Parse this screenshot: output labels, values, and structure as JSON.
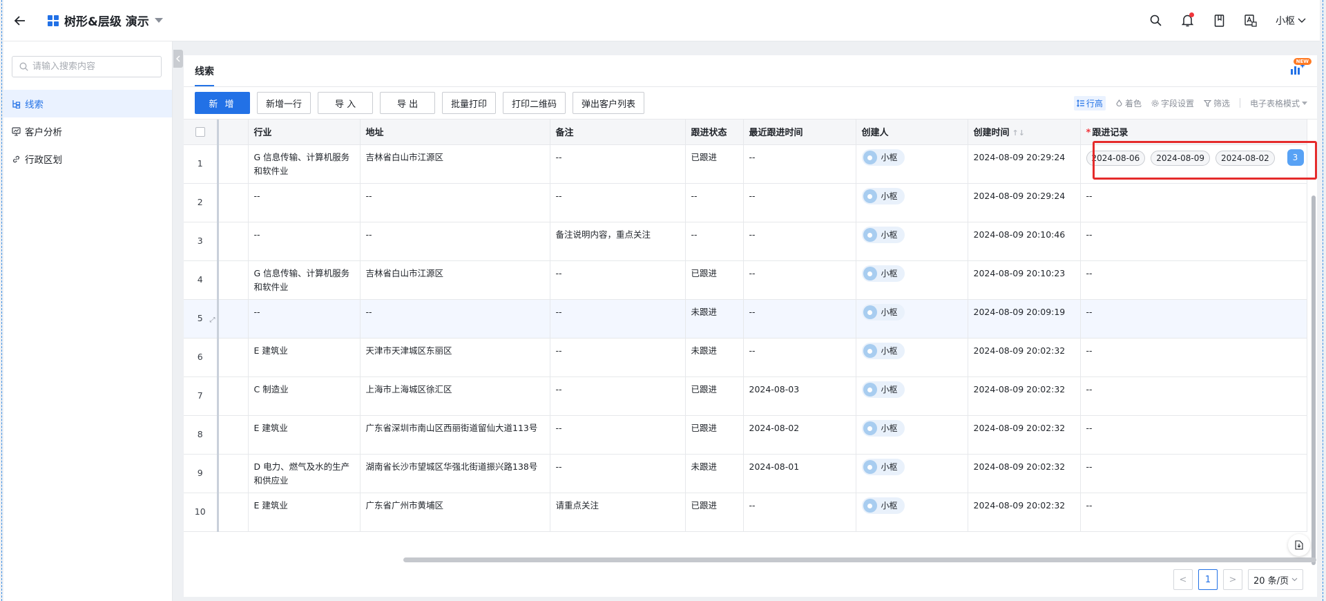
{
  "header": {
    "title": "树形&层级 演示",
    "user_name": "小枢",
    "icons": [
      "back-arrow-icon",
      "app-grid-icon",
      "search-icon",
      "bell-icon",
      "book-icon",
      "translate-icon",
      "chevron-down-icon"
    ],
    "notification_dot_color": "#f0353b"
  },
  "sidebar": {
    "search_placeholder": "请输入搜索内容",
    "items": [
      {
        "label": "线索",
        "icon": "tree-icon",
        "active": true
      },
      {
        "label": "客户分析",
        "icon": "chart-screen-icon",
        "active": false
      },
      {
        "label": "行政区划",
        "icon": "link-icon",
        "active": false
      }
    ]
  },
  "tabs": [
    {
      "label": "线索",
      "active": true
    }
  ],
  "widget_badge": "NEW",
  "toolbar": {
    "add": "新 增",
    "add_row": "新增一行",
    "import": "导 入",
    "export": "导 出",
    "batch_print": "批量打印",
    "print_qr": "打印二维码",
    "popup_list": "弹出客户列表",
    "row_height": "行高",
    "coloring": "着色",
    "field_settings": "字段设置",
    "filter": "筛选",
    "sheet_mode": "电子表格模式"
  },
  "table": {
    "columns": [
      "行业",
      "地址",
      "备注",
      "跟进状态",
      "最近跟进时间",
      "创建人",
      "创建时间",
      "跟进记录"
    ],
    "required_marker": "*",
    "rows": [
      {
        "no": "1",
        "industry": "G 信息传输、计算机服务和软件业",
        "address": "吉林省白山市江源区",
        "remark": "--",
        "status": "已跟进",
        "last_follow": "--",
        "creator": "小枢",
        "created": "2024-08-09 20:29:24",
        "records": [
          "2024-08-06",
          "2024-08-09",
          "2024-08-02"
        ],
        "records_count": "3"
      },
      {
        "no": "2",
        "industry": "--",
        "address": "--",
        "remark": "--",
        "status": "--",
        "last_follow": "--",
        "creator": "小枢",
        "created": "2024-08-09 20:29:24",
        "records_text": "--"
      },
      {
        "no": "3",
        "industry": "--",
        "address": "--",
        "remark": "备注说明内容，重点关注",
        "status": "--",
        "last_follow": "--",
        "creator": "小枢",
        "created": "2024-08-09 20:10:46",
        "records_text": "--"
      },
      {
        "no": "4",
        "industry": "G 信息传输、计算机服务和软件业",
        "address": "吉林省白山市江源区",
        "remark": "--",
        "status": "已跟进",
        "last_follow": "--",
        "creator": "小枢",
        "created": "2024-08-09 20:10:23",
        "records_text": "--"
      },
      {
        "no": "5",
        "industry": "--",
        "address": "--",
        "remark": "--",
        "status": "未跟进",
        "last_follow": "--",
        "creator": "小枢",
        "created": "2024-08-09 20:09:19",
        "records_text": "--",
        "highlight": true
      },
      {
        "no": "6",
        "industry": "E 建筑业",
        "address": "天津市天津城区东丽区",
        "remark": "--",
        "status": "未跟进",
        "last_follow": "--",
        "creator": "小枢",
        "created": "2024-08-09 20:02:32",
        "records_text": "--"
      },
      {
        "no": "7",
        "industry": "C 制造业",
        "address": "上海市上海城区徐汇区",
        "remark": "--",
        "status": "已跟进",
        "last_follow": "2024-08-03",
        "creator": "小枢",
        "created": "2024-08-09 20:02:32",
        "records_text": "--"
      },
      {
        "no": "8",
        "industry": "E 建筑业",
        "address": "广东省深圳市南山区西丽街道留仙大道113号",
        "remark": "--",
        "status": "已跟进",
        "last_follow": "2024-08-02",
        "creator": "小枢",
        "created": "2024-08-09 20:02:32",
        "records_text": "--"
      },
      {
        "no": "9",
        "industry": "D 电力、燃气及水的生产和供应业",
        "address": "湖南省长沙市望城区华强北街道振兴路138号",
        "remark": "--",
        "status": "未跟进",
        "last_follow": "2024-08-01",
        "creator": "小枢",
        "created": "2024-08-09 20:02:32",
        "records_text": "--"
      },
      {
        "no": "10",
        "industry": "E 建筑业",
        "address": "广东省广州市黄埔区",
        "remark": "请重点关注",
        "status": "已跟进",
        "last_follow": "--",
        "creator": "小枢",
        "created": "2024-08-09 20:02:32",
        "records_text": "--"
      }
    ]
  },
  "pagination": {
    "prev": "<",
    "current": "1",
    "next": ">",
    "page_size": "20 条/页"
  },
  "colors": {
    "primary": "#2271e6",
    "highlight_box": "#e52b2b",
    "active_bg": "#eaf2ff"
  }
}
